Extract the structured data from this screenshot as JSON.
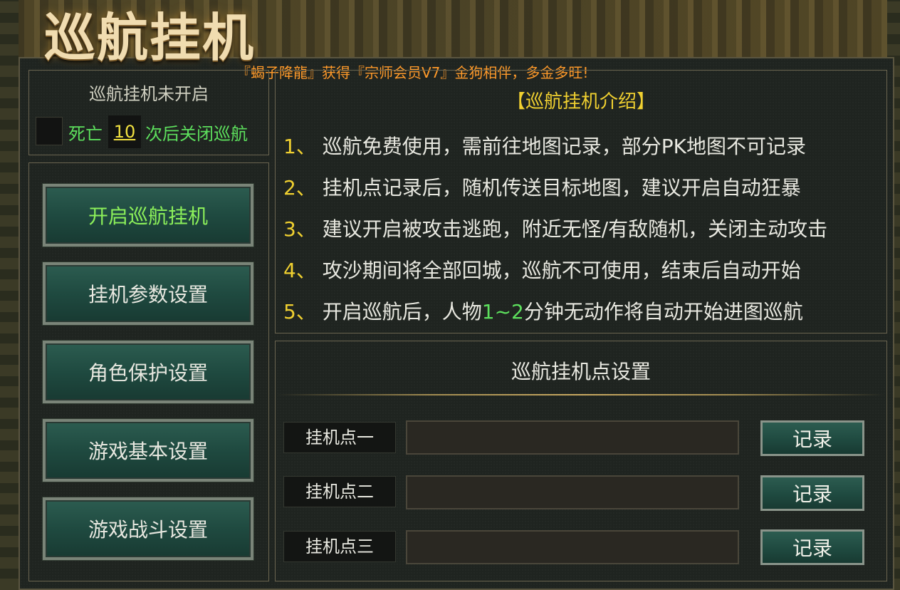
{
  "window": {
    "title": "巡航挂机",
    "notice": "『蝎子降龍』获得『宗师会员V7』金狗相伴，多金多旺!"
  },
  "status": {
    "title": "巡航挂机未开启",
    "death_prefix": "死亡",
    "death_count": "10",
    "death_suffix": "次后关闭巡航"
  },
  "menu": {
    "items": [
      {
        "label": "开启巡航挂机"
      },
      {
        "label": "挂机参数设置"
      },
      {
        "label": "角色保护设置"
      },
      {
        "label": "游戏基本设置"
      },
      {
        "label": "游戏战斗设置"
      }
    ]
  },
  "intro": {
    "title": "【巡航挂机介绍】",
    "lines": [
      {
        "num": "1、",
        "text": "巡航免费使用，需前往地图记录，部分PK地图不可记录"
      },
      {
        "num": "2、",
        "text": "挂机点记录后，随机传送目标地图，建议开启自动狂暴"
      },
      {
        "num": "3、",
        "text": "建议开启被攻击逃跑，附近无怪/有敌随机，关闭主动攻击"
      },
      {
        "num": "4、",
        "text": "攻沙期间将全部回城，巡航不可使用，结束后自动开始"
      },
      {
        "num": "5、",
        "text_a": "开启巡航后，人物",
        "highlight": "1~2",
        "text_b": "分钟无动作将自动开始进图巡航"
      }
    ]
  },
  "points": {
    "title": "巡航挂机点设置",
    "rows": [
      {
        "label": "挂机点一",
        "value": "",
        "button": "记录"
      },
      {
        "label": "挂机点二",
        "value": "",
        "button": "记录"
      },
      {
        "label": "挂机点三",
        "value": "",
        "button": "记录"
      }
    ]
  },
  "colors": {
    "accent_yellow": "#f0d030",
    "accent_green": "#5de05d",
    "notice_orange": "#ff9a2a",
    "button_teal": "#1f4a40"
  }
}
